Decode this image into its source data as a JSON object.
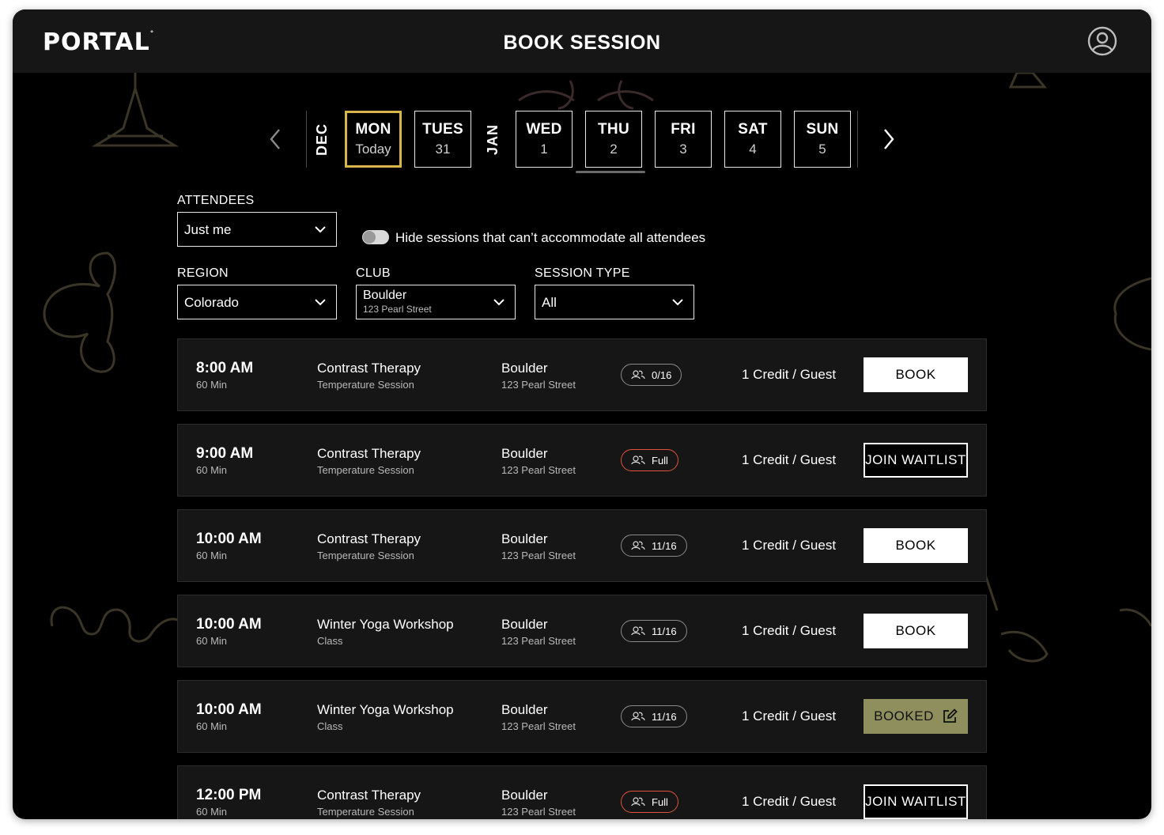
{
  "app": {
    "logo": "PORTAL",
    "logo_mark": "°",
    "title": "BOOK SESSION"
  },
  "icons": {
    "account": "user-circle-icon",
    "prev": "chevron-left-icon",
    "next": "chevron-right-icon",
    "capacity": "people-icon",
    "edit": "edit-icon",
    "dropdown": "chevron-down-icon"
  },
  "colors": {
    "today_border": "#d8b64a",
    "full_badge": "#e0533a",
    "booked_button": "#8e8f5d"
  },
  "calendar": {
    "months": [
      "DEC",
      "JAN"
    ],
    "days": [
      {
        "name": "MON",
        "date": "Today"
      },
      {
        "name": "TUES",
        "date": "31"
      },
      {
        "name": "WED",
        "date": "1"
      },
      {
        "name": "THU",
        "date": "2"
      },
      {
        "name": "FRI",
        "date": "3"
      },
      {
        "name": "SAT",
        "date": "4"
      },
      {
        "name": "SUN",
        "date": "5"
      }
    ]
  },
  "filters": {
    "attendees": {
      "label": "ATTENDEES",
      "value": "Just me"
    },
    "hide_toggle": {
      "label": "Hide sessions that can’t accommodate all attendees",
      "on": false
    },
    "region": {
      "label": "REGION",
      "value": "Colorado"
    },
    "club": {
      "label": "CLUB",
      "value": "Boulder",
      "sub": "123 Pearl Street"
    },
    "session_type": {
      "label": "SESSION TYPE",
      "value": "All"
    }
  },
  "sessions": [
    {
      "time": "8:00 AM",
      "duration": "60 Min",
      "name": "Contrast Therapy",
      "type": "Temperature Session",
      "location": "Boulder",
      "address": "123 Pearl Street",
      "capacity": "0/16",
      "credit": "1 Credit / Guest",
      "action": "BOOK"
    },
    {
      "time": "9:00 AM",
      "duration": "60 Min",
      "name": "Contrast Therapy",
      "type": "Temperature Session",
      "location": "Boulder",
      "address": "123 Pearl Street",
      "capacity": "Full",
      "credit": "1 Credit / Guest",
      "action": "JOIN WAITLIST"
    },
    {
      "time": "10:00 AM",
      "duration": "60 Min",
      "name": "Contrast Therapy",
      "type": "Temperature Session",
      "location": "Boulder",
      "address": "123 Pearl Street",
      "capacity": "11/16",
      "credit": "1 Credit / Guest",
      "action": "BOOK"
    },
    {
      "time": "10:00 AM",
      "duration": "60 Min",
      "name": "Winter Yoga Workshop",
      "type": "Class",
      "location": "Boulder",
      "address": "123 Pearl Street",
      "capacity": "11/16",
      "credit": "1 Credit / Guest",
      "action": "BOOK"
    },
    {
      "time": "10:00 AM",
      "duration": "60 Min",
      "name": "Winter Yoga Workshop",
      "type": "Class",
      "location": "Boulder",
      "address": "123 Pearl Street",
      "capacity": "11/16",
      "credit": "1 Credit / Guest",
      "action": "BOOKED"
    },
    {
      "time": "12:00 PM",
      "duration": "60 Min",
      "name": "Contrast Therapy",
      "type": "Temperature Session",
      "location": "Boulder",
      "address": "123 Pearl Street",
      "capacity": "Full",
      "credit": "1 Credit / Guest",
      "action": "JOIN WAITLIST"
    }
  ]
}
